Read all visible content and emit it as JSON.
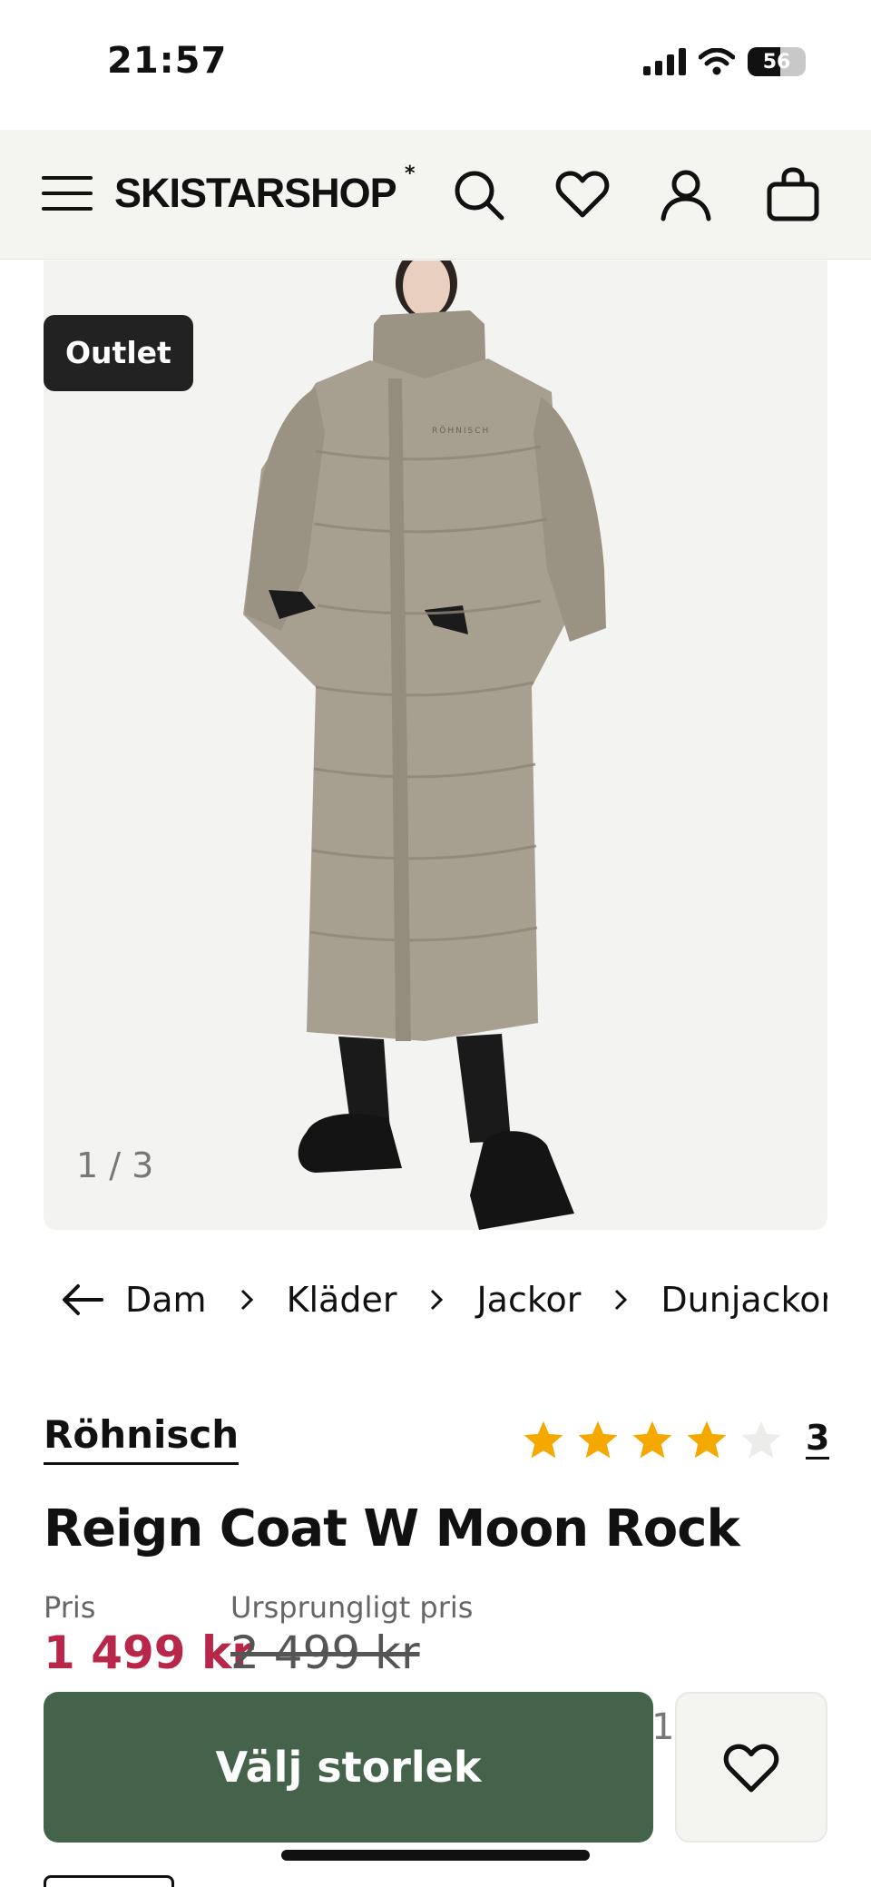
{
  "status_bar": {
    "time": "21:57",
    "battery_level": "56",
    "icons": [
      "signal-icon",
      "wifi-icon",
      "battery-icon"
    ]
  },
  "header": {
    "logo": "SKISTARSHOP",
    "logo_mark": "*",
    "icons": [
      "menu-icon",
      "search-icon",
      "heart-icon",
      "user-icon",
      "bag-icon"
    ]
  },
  "gallery": {
    "badge": "Outlet",
    "counter": "1 / 3",
    "image_description": "woman wearing long taupe down coat"
  },
  "breadcrumb": {
    "back_icon": "arrow-left-icon",
    "items": [
      "Dam",
      "Kläder",
      "Jackor",
      "Dunjackor"
    ]
  },
  "product": {
    "brand": "Röhnisch",
    "rating": {
      "value": 4,
      "max": 5,
      "count": "3"
    },
    "title": "Reign Coat W Moon Rock",
    "price_label": "Pris",
    "price": "1 499 kr",
    "original_price_label": "Ursprungligt pris",
    "original_price": "2 499 kr"
  },
  "actions": {
    "select_size": "Välj storlek",
    "favorite_icon": "heart-icon",
    "peek_text": "1"
  },
  "colors": {
    "brand_green": "#45634b",
    "sale_red": "#b8274a",
    "star_yellow": "#f5a800",
    "header_bg": "#f4f4f1"
  }
}
